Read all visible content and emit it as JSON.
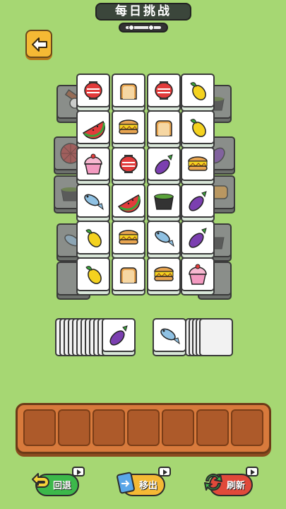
{
  "header": {
    "title": "每日挑战"
  },
  "back": {
    "icon": "arrow-left-icon"
  },
  "tools": {
    "undo": {
      "label": "回退",
      "icon": "undo-arrow-icon"
    },
    "move_out": {
      "label": "移出",
      "icon": "card-move-icon"
    },
    "shuffle": {
      "label": "刷新",
      "icon": "shuffle-icon"
    }
  },
  "tray": {
    "slots": 7
  },
  "colors": {
    "background": "#a6d773",
    "tray": "#d87a3c",
    "button_yellow": "#f5b934"
  }
}
